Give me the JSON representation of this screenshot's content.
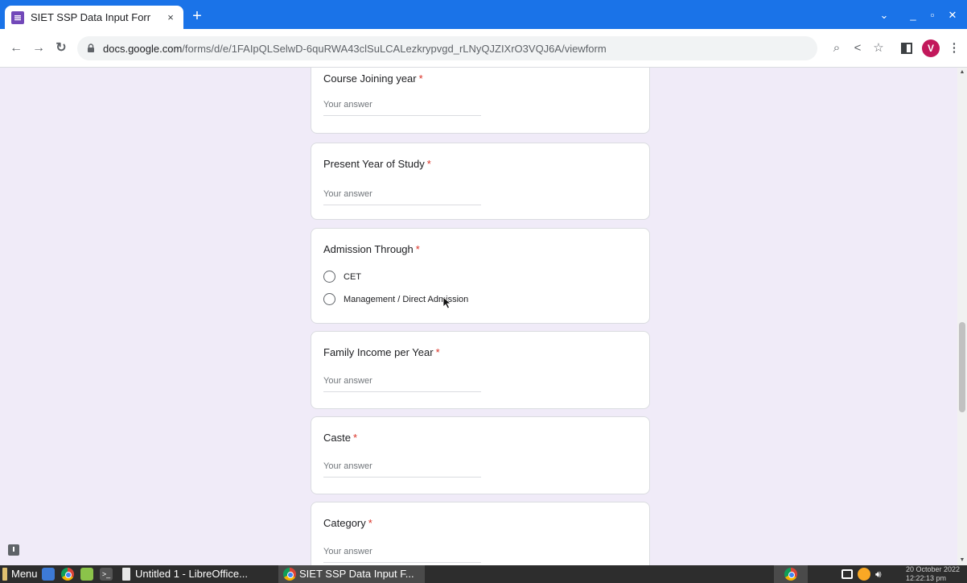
{
  "browser": {
    "tab_title": "SIET SSP Data Input Forr",
    "tab_close": "×",
    "new_tab": "+",
    "url_host": "docs.google.com",
    "url_path": "/forms/d/e/1FAIpQLSelwD-6quRWA43clSuLCALezkrypvgd_rLNyQJZIXrO3VQJ6A/viewform",
    "profile_initial": "V",
    "accent": "#1a73e8"
  },
  "form": {
    "required_mark": "*",
    "answer_placeholder": "Your answer",
    "questions": [
      {
        "title": "Course Joining year",
        "type": "text"
      },
      {
        "title": "Present Year of Study",
        "type": "text"
      },
      {
        "title": "Admission Through",
        "type": "radio",
        "options": [
          "CET",
          "Management / Direct Admission"
        ]
      },
      {
        "title": "Family Income per Year",
        "type": "text"
      },
      {
        "title": "Caste",
        "type": "text"
      },
      {
        "title": "Category",
        "type": "text"
      }
    ]
  },
  "taskbar": {
    "menu_label": "Menu",
    "task_libreoffice": "Untitled 1 - LibreOffice...",
    "task_chrome": "SIET SSP Data Input F...",
    "clock_date": "20 October 2022",
    "clock_time": "12:22:13 pm"
  }
}
